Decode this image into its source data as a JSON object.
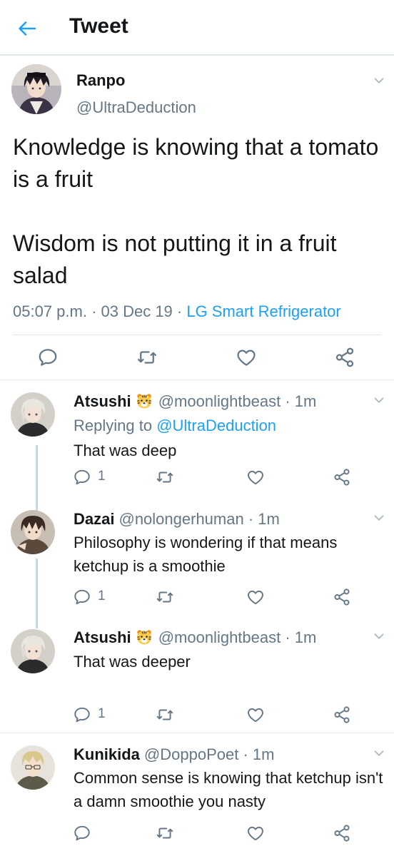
{
  "header": {
    "title": "Tweet"
  },
  "main_tweet": {
    "name": "Ranpo",
    "handle": "@UltraDeduction",
    "text_1": "Knowledge is knowing that a tomato is a fruit",
    "text_2": "Wisdom is not putting it in a fruit salad",
    "time": "05:07 p.m. · 03 Dec 19 · ",
    "source": "LG Smart Refrigerator"
  },
  "replies": [
    {
      "name": "Atsushi",
      "handle": "@moonlightbeast · 1m",
      "replying_prefix": "Replying to ",
      "replying_to": "@UltraDeduction",
      "text": "That was deep",
      "reply_count": "1"
    },
    {
      "name": "Dazai",
      "handle": "@nolongerhuman · 1m",
      "text": "Philosophy is wondering if that means ketchup is a smoothie",
      "reply_count": "1"
    },
    {
      "name": "Atsushi",
      "handle": "@moonlightbeast · 1m",
      "text": "That was deeper",
      "reply_count": "1"
    },
    {
      "name": "Kunikida",
      "handle": "@DoppoPoet · 1m",
      "text": "Common sense is knowing that ketchup isn't a damn smoothie you nasty"
    }
  ],
  "colors": {
    "accent": "#1da1f2",
    "muted": "#657786",
    "divider": "#e1e8ed"
  },
  "icons": [
    "back-arrow-icon",
    "chevron-down-icon",
    "reply-icon",
    "retweet-icon",
    "like-icon",
    "share-icon",
    "tiger-emoji-icon"
  ]
}
